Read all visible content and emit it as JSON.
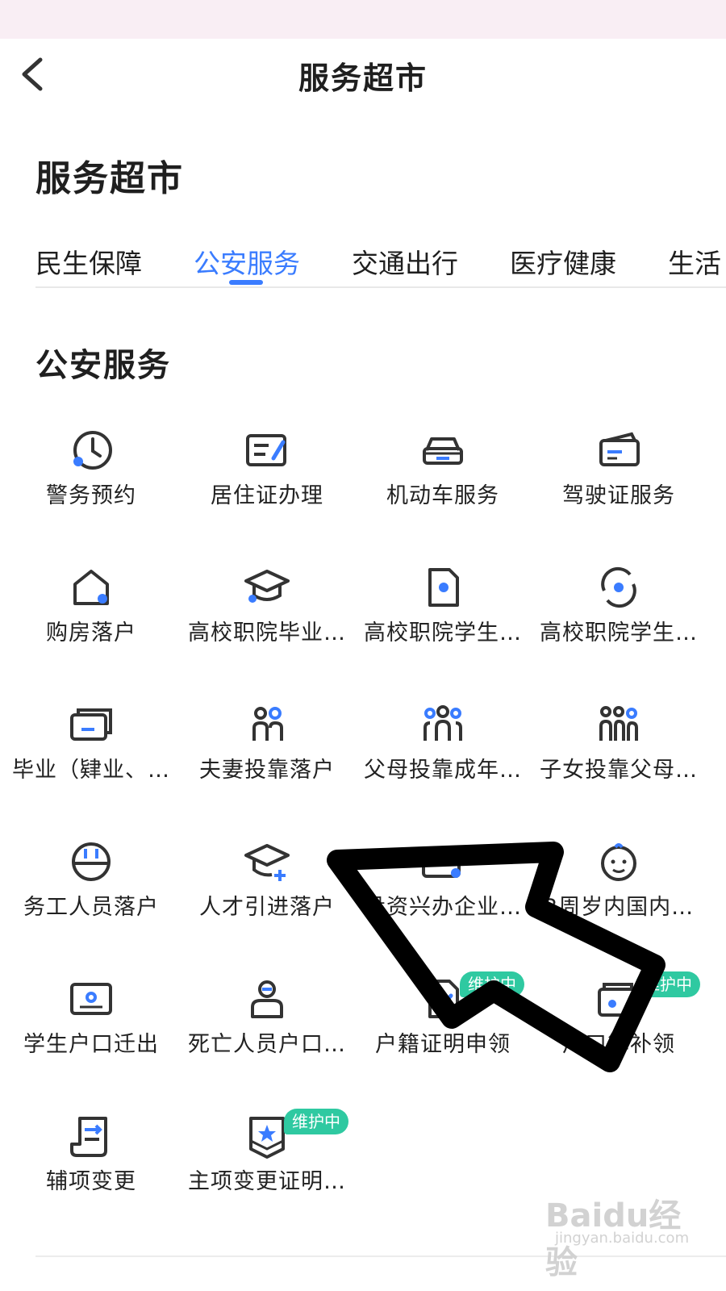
{
  "header": {
    "title": "服务超市"
  },
  "page_title": "服务超市",
  "tabs": [
    {
      "label": "民生保障"
    },
    {
      "label": "公安服务"
    },
    {
      "label": "交通出行"
    },
    {
      "label": "医疗健康"
    },
    {
      "label": "生活"
    }
  ],
  "section_title": "公安服务",
  "services": [
    {
      "label": "警务预约",
      "icon": "clock-icon"
    },
    {
      "label": "居住证办理",
      "icon": "id-card-icon"
    },
    {
      "label": "机动车服务",
      "icon": "car-icon"
    },
    {
      "label": "驾驶证服务",
      "icon": "license-card-icon"
    },
    {
      "label": "购房落户",
      "icon": "house-pin-icon"
    },
    {
      "label": "高校职院毕业…",
      "icon": "graduation-cap-icon"
    },
    {
      "label": "高校职院学生…",
      "icon": "document-pin-icon"
    },
    {
      "label": "高校职院学生…",
      "icon": "refresh-pin-icon"
    },
    {
      "label": "毕业（肄业、…",
      "icon": "cards-icon"
    },
    {
      "label": "夫妻投靠落户",
      "icon": "couple-icon"
    },
    {
      "label": "父母投靠成年…",
      "icon": "family-icon"
    },
    {
      "label": "子女投靠父母…",
      "icon": "children-icon"
    },
    {
      "label": "务工人员落户",
      "icon": "worker-helmet-icon"
    },
    {
      "label": "人才引进落户",
      "icon": "talent-cap-icon"
    },
    {
      "label": "投资兴办企业…",
      "icon": "business-card-icon"
    },
    {
      "label": "3周岁内国内…",
      "icon": "baby-face-icon"
    },
    {
      "label": "学生户口迁出",
      "icon": "id-frame-icon"
    },
    {
      "label": "死亡人员户口…",
      "icon": "person-minus-icon"
    },
    {
      "label": "户籍证明申领",
      "icon": "document-edit-icon",
      "badge": "维护中"
    },
    {
      "label": "户口簿补领",
      "icon": "wallet-icon",
      "badge": "维护中"
    },
    {
      "label": "辅项变更",
      "icon": "scroll-swap-icon"
    },
    {
      "label": "主项变更证明…",
      "icon": "envelope-star-icon",
      "badge": "维护中"
    }
  ],
  "watermark": {
    "brand": "Baidu经验",
    "url": "jingyan.baidu.com"
  },
  "colors": {
    "accent": "#3a7cff",
    "badge": "#2fc9a1",
    "status_bar": "#f9eef4"
  }
}
